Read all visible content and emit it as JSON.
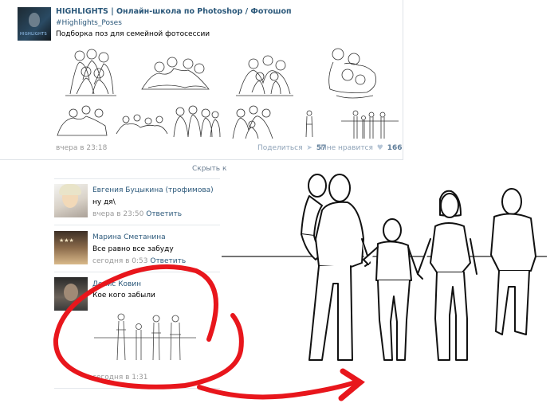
{
  "post": {
    "author": "HIGHLIGHTS | Онлайн-школа по Photoshop / Фотошоп",
    "hashtag": "#Highlights_Poses",
    "text": "Подборка поз для семейной фотосессии",
    "avatar_caption": "HIGHLIGHTS",
    "time": "вчера в 23:18",
    "share_label": "Поделиться",
    "share_count": "57",
    "like_label": "Мне нравится",
    "like_count": "166"
  },
  "hide_comments_label": "Скрыть к",
  "comments": [
    {
      "name": "Евгения Буцыкина (трофимова)",
      "text": "ну дя\\",
      "time": "вчера в 23:50",
      "reply": "Ответить"
    },
    {
      "name": "Марина Сметанина",
      "text": "Все равно все забуду",
      "time": "сегодня в 0:53",
      "reply": "Ответить"
    },
    {
      "name": "Денис Ковин",
      "text": "Кое кого забыли",
      "time": "сегодня в 1:31",
      "reply": ""
    }
  ],
  "icons": {
    "share": "megaphone-icon",
    "like": "heart-icon"
  },
  "colors": {
    "link": "#2b587a",
    "annotation": "#e8161c",
    "muted": "#999999"
  }
}
